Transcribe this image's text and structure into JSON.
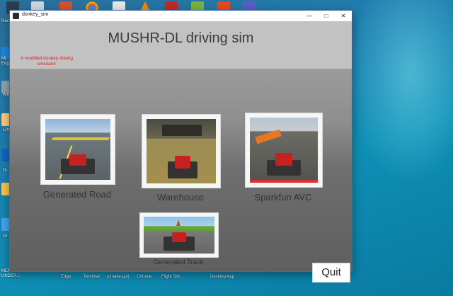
{
  "window": {
    "title": "donkey_sim",
    "app_title": "MUSHR-DL driving sim",
    "subtitle": "A modified donkey driving simulator"
  },
  "tracks": [
    {
      "label": "Generated Road"
    },
    {
      "label": "Warehouse"
    },
    {
      "label": "Sparkfun AVC"
    },
    {
      "label": "Generated Track"
    }
  ],
  "quit_label": "Quit",
  "desktop": {
    "left_icons": [
      "Recy",
      "Mi",
      "Edge",
      "Ani",
      "LPU",
      "Di",
      "Gr"
    ],
    "taskbar_labels": [
      "MEM OF UNDER...",
      "Edge",
      "Terminal",
      "(cmake-gui)",
      "Chrome",
      "Flight Sim...",
      "Desktop App"
    ]
  }
}
